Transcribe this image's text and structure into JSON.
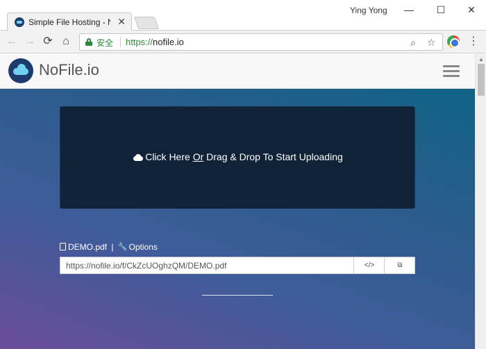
{
  "browser": {
    "tab_title": "Simple File Hosting - No",
    "tab_close": "✕",
    "profile_name": "Ying Yong",
    "window_minimize": "—",
    "window_maximize": "☐",
    "window_close": "✕",
    "back": "←",
    "forward": "→",
    "reload": "⟳",
    "home": "⌂",
    "secure_label": "安全",
    "url_scheme": "https://",
    "url_host": "nofile.io",
    "zoom_glyph": "⌕",
    "star_glyph": "☆",
    "menu_glyph": "⋮",
    "icons": [
      "favicon-icon",
      "back-icon",
      "forward-icon",
      "reload-icon",
      "home-icon",
      "lock-icon",
      "zoom-icon",
      "star-icon",
      "extension-icon",
      "menu-icon"
    ]
  },
  "site": {
    "logo_text": "NoFile.io",
    "upload": {
      "text_before": "Click Here ",
      "text_or": "Or",
      "text_after": " Drag & Drop To Start Uploading"
    },
    "file": {
      "name": "DEMO.pdf",
      "separator": "|",
      "options_label": "Options",
      "link": "https://nofile.io/f/CkZcUOghzQM/DEMO.pdf",
      "embed_glyph": "</>",
      "copy_glyph": "⧉"
    },
    "colors": {
      "dropzone": "#0f2237",
      "gradient_start": "#6a4c9a",
      "gradient_end": "#0f6384",
      "secure_green": "#2a8a3a"
    }
  }
}
